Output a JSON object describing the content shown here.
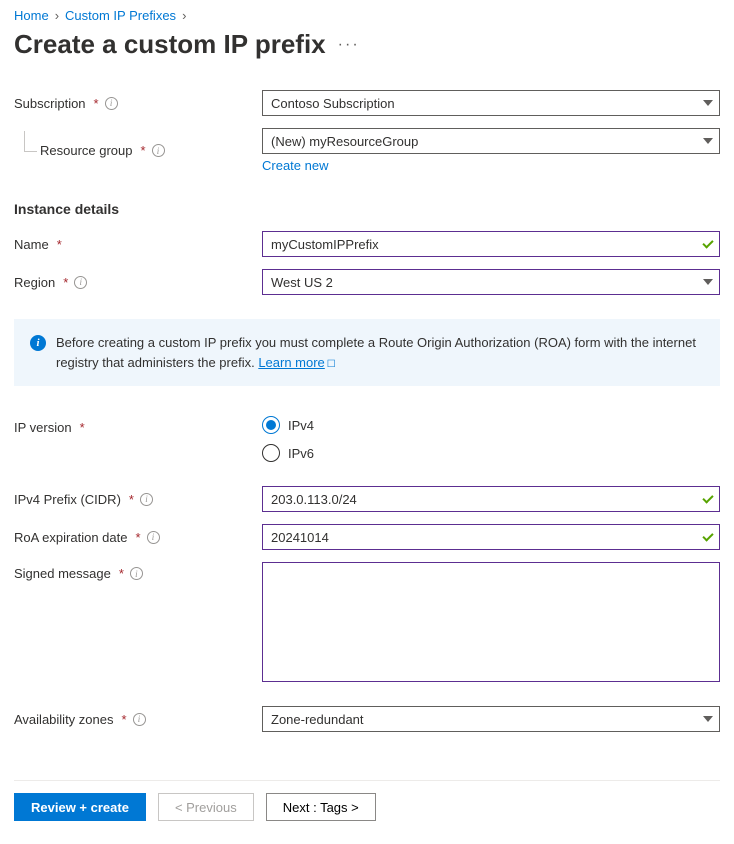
{
  "breadcrumb": {
    "home": "Home",
    "section": "Custom IP Prefixes"
  },
  "title": "Create a custom IP prefix",
  "labels": {
    "subscription": "Subscription",
    "resource_group": "Resource group",
    "create_new": "Create new",
    "instance_details": "Instance details",
    "name": "Name",
    "region": "Region",
    "ip_version": "IP version",
    "ipv4_prefix": "IPv4 Prefix (CIDR)",
    "roa_date": "RoA expiration date",
    "signed_message": "Signed message",
    "availability_zones": "Availability zones"
  },
  "values": {
    "subscription": "Contoso Subscription",
    "resource_group": "(New) myResourceGroup",
    "name": "myCustomIPPrefix",
    "region": "West US 2",
    "ipv4": "IPv4",
    "ipv6": "IPv6",
    "ipv4_prefix": "203.0.113.0/24",
    "roa_date": "20241014",
    "signed_message": "",
    "availability_zones": "Zone-redundant"
  },
  "banner": {
    "text": "Before creating a custom IP prefix you must complete a Route Origin Authorization (ROA) form with the internet registry that administers the prefix. ",
    "learn_more": "Learn more"
  },
  "buttons": {
    "review": "Review + create",
    "previous": "< Previous",
    "next": "Next : Tags >"
  }
}
